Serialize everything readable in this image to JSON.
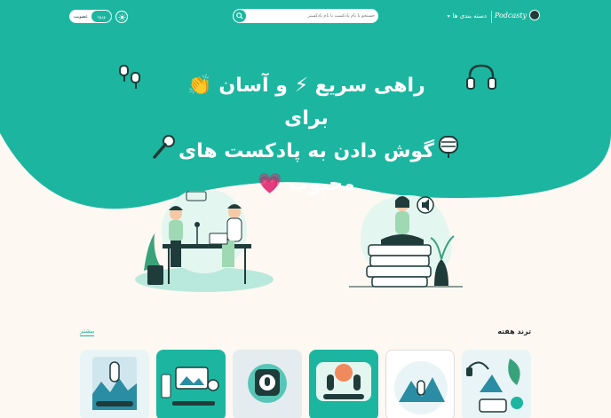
{
  "header": {
    "logo_text": "Podcasty",
    "categories_label": "دسته بندی ها",
    "search_placeholder": "جستجو با نام پادکست یا نام پادکستر",
    "register_label": "عضویت",
    "login_label": "ورود"
  },
  "hero": {
    "line1": "راهی سریع ⚡ و آسان 👏 برای",
    "line2": "گوش دادن به پادکست های",
    "line3": "محبوب 💗"
  },
  "trending": {
    "title": "ترند هفته",
    "more_label": "بیشتر"
  },
  "colors": {
    "accent": "#1cb6a0",
    "background": "#fdf8f2",
    "dark": "#1f3b3a"
  }
}
